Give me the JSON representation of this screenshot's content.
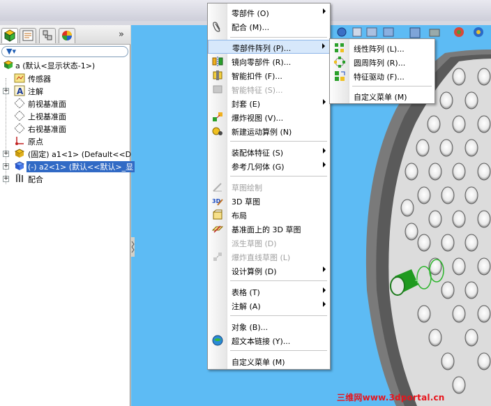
{
  "tree": {
    "root": "a  (默认<显示状态-1>)",
    "items": [
      {
        "label": "传感器",
        "icon": "sensor-icon",
        "expand": false
      },
      {
        "label": "注解",
        "icon": "annotation-icon",
        "expand": true
      },
      {
        "label": "前视基准面",
        "icon": "plane-icon",
        "expand": false
      },
      {
        "label": "上视基准面",
        "icon": "plane-icon",
        "expand": false
      },
      {
        "label": "右视基准面",
        "icon": "plane-icon",
        "expand": false
      },
      {
        "label": "原点",
        "icon": "origin-icon",
        "expand": false
      },
      {
        "label": "(固定) a1<1> (Default<<D",
        "icon": "part-icon",
        "expand": true
      },
      {
        "label": "(-) a2<1> (默认<<默认>_显",
        "icon": "part-icon",
        "expand": true,
        "selected": true
      },
      {
        "label": "配合",
        "icon": "mates-icon",
        "expand": true
      }
    ]
  },
  "menu": {
    "items": [
      {
        "label": "零部件 (O)",
        "icon": "",
        "arrow": true
      },
      {
        "label": "配合 (M)...",
        "icon": "paperclip-icon"
      },
      {
        "label": "零部件阵列 (P)...",
        "icon": "",
        "arrow": true,
        "highlight": true
      },
      {
        "label": "镜向零部件 (R)...",
        "icon": "mirror-icon"
      },
      {
        "label": "智能扣件 (F)...",
        "icon": "fastener-icon"
      },
      {
        "label": "智能特征 (S)...",
        "icon": "smart-feature-icon",
        "disabled": true
      },
      {
        "label": "封套 (E)",
        "icon": "",
        "arrow": true
      },
      {
        "label": "爆炸视图 (V)...",
        "icon": "explode-icon"
      },
      {
        "label": "新建运动算例 (N)",
        "icon": "motion-study-icon"
      },
      {
        "label": "装配体特征 (S)",
        "icon": "",
        "arrow": true
      },
      {
        "label": "参考几何体 (G)",
        "icon": "",
        "arrow": true
      },
      {
        "label": "草图绘制",
        "icon": "sketch-icon",
        "disabled": true
      },
      {
        "label": "3D 草图",
        "icon": "3d-sketch-icon"
      },
      {
        "label": "布局",
        "icon": "layout-icon"
      },
      {
        "label": "基准面上的 3D 草图",
        "icon": "3d-sketch-plane-icon"
      },
      {
        "label": "派生草图 (D)",
        "icon": "",
        "disabled": true
      },
      {
        "label": "爆炸直线草图 (L)",
        "icon": "explode-line-icon",
        "disabled": true
      },
      {
        "label": "设计算例 (D)",
        "icon": "",
        "arrow": true
      },
      {
        "label": "表格 (T)",
        "icon": "",
        "arrow": true
      },
      {
        "label": "注解 (A)",
        "icon": "",
        "arrow": true
      },
      {
        "label": "对象 (B)...",
        "icon": ""
      },
      {
        "label": "超文本链接 (Y)...",
        "icon": "hyperlink-icon"
      },
      {
        "label": "自定义菜单 (M)",
        "icon": ""
      }
    ]
  },
  "submenu": {
    "items": [
      {
        "label": "线性阵列 (L)...",
        "icon": "linear-pattern-icon"
      },
      {
        "label": "圆周阵列 (R)...",
        "icon": "circular-pattern-icon"
      },
      {
        "label": "特征驱动 (F)...",
        "icon": "feature-driven-icon"
      },
      {
        "label": "自定义菜单 (M)",
        "icon": ""
      }
    ]
  },
  "watermark": "三维网www.3dportal.cn"
}
